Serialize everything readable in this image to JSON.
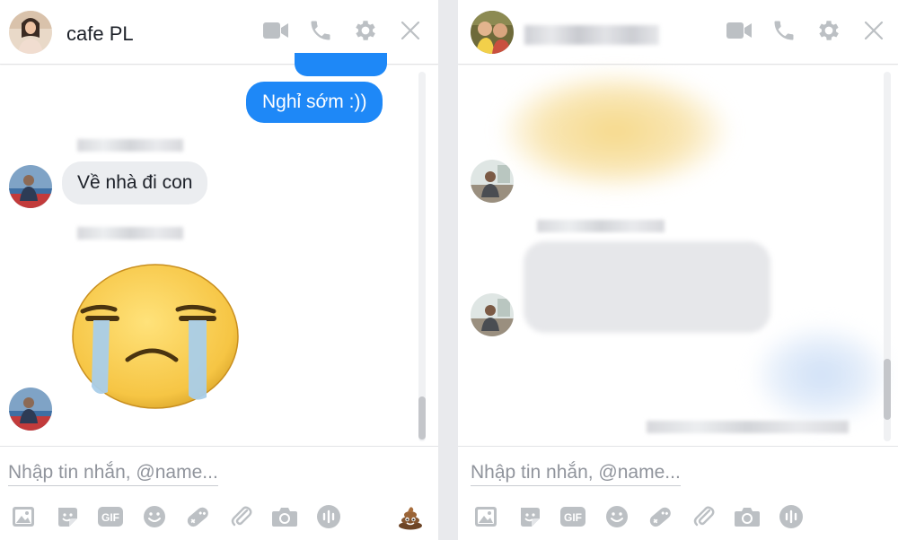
{
  "left_chat": {
    "contact_name": "cafe PL",
    "messages": {
      "sent_2": "Nghỉ sớm :))",
      "received_1": "Về nhà đi con"
    },
    "composer_placeholder": "Nhập tin nhắn, @name..."
  },
  "right_chat": {
    "composer_placeholder": "Nhập tin nhắn, @name..."
  },
  "colors": {
    "accent": "#1e88f7",
    "icon_gray": "#bcc0c4",
    "bubble_gray": "#ebedf0"
  },
  "icons": {
    "header": [
      "video-camera-icon",
      "phone-icon",
      "gear-icon",
      "close-icon"
    ],
    "toolbar": [
      "photo-icon",
      "sticker-icon",
      "gif-icon",
      "emoji-icon",
      "game-icon",
      "attachment-icon",
      "camera-icon",
      "audio-icon"
    ],
    "left_extra": "poop-emoji-icon"
  }
}
